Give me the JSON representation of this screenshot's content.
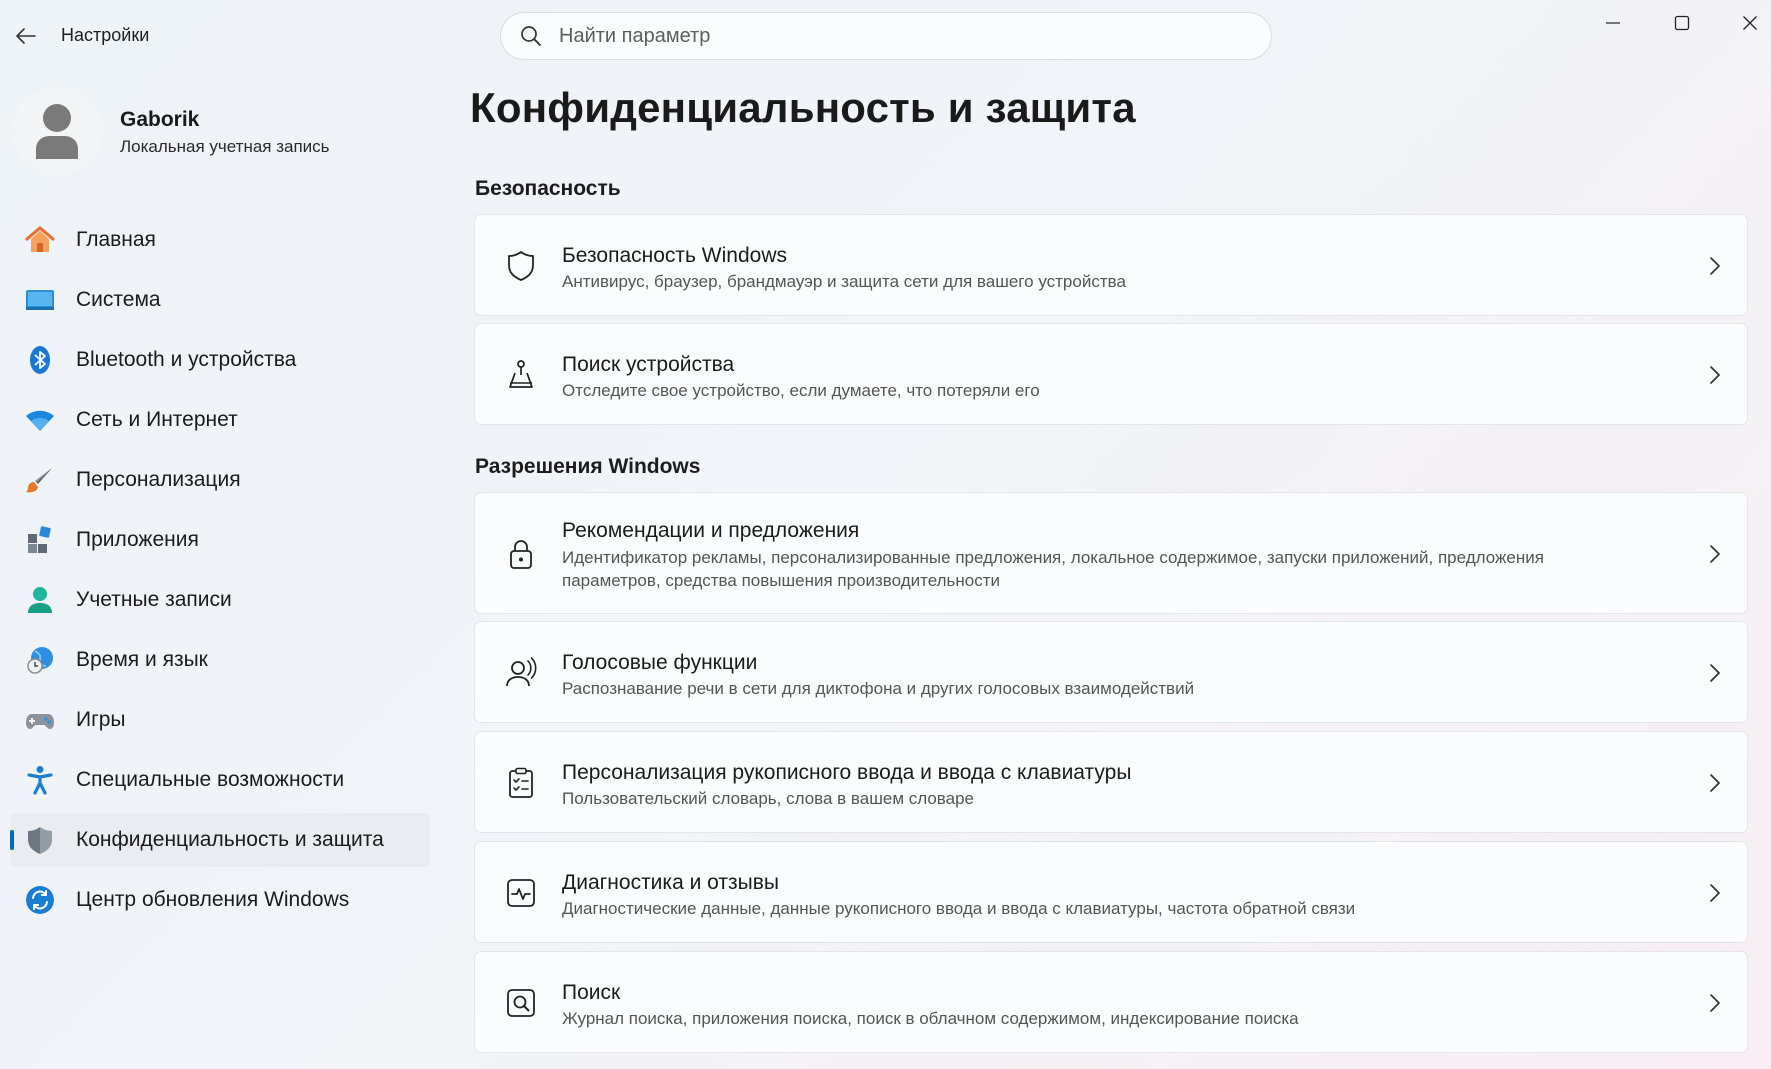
{
  "app": {
    "title": "Настройки",
    "search_placeholder": "Найти параметр"
  },
  "profile": {
    "name": "Gaborik",
    "account_type": "Локальная учетная запись"
  },
  "sidebar": {
    "items": [
      {
        "label": "Главная",
        "icon": "home-icon"
      },
      {
        "label": "Система",
        "icon": "system-icon"
      },
      {
        "label": "Bluetooth и устройства",
        "icon": "bluetooth-icon"
      },
      {
        "label": "Сеть и Интернет",
        "icon": "wifi-icon"
      },
      {
        "label": "Персонализация",
        "icon": "brush-icon"
      },
      {
        "label": "Приложения",
        "icon": "apps-icon"
      },
      {
        "label": "Учетные записи",
        "icon": "accounts-icon"
      },
      {
        "label": "Время и язык",
        "icon": "time-language-icon"
      },
      {
        "label": "Игры",
        "icon": "gamepad-icon"
      },
      {
        "label": "Специальные возможности",
        "icon": "accessibility-icon"
      },
      {
        "label": "Конфиденциальность и защита",
        "icon": "shield-icon",
        "active": true
      },
      {
        "label": "Центр обновления Windows",
        "icon": "update-icon"
      }
    ]
  },
  "main": {
    "title": "Конфиденциальность и защита",
    "sections": [
      {
        "title": "Безопасность",
        "cards": [
          {
            "title": "Безопасность Windows",
            "desc": "Антивирус, браузер, брандмауэр и защита сети для вашего устройства",
            "icon": "shield-outline-icon"
          },
          {
            "title": "Поиск устройства",
            "desc": "Отследите свое устройство, если думаете, что потеряли его",
            "icon": "find-device-icon"
          }
        ]
      },
      {
        "title": "Разрешения Windows",
        "cards": [
          {
            "title": "Рекомендации и предложения",
            "desc": "Идентификатор рекламы, персонализированные предложения, локальное содержимое, запуски приложений, предложения параметров, средства повышения производительности",
            "icon": "lock-icon"
          },
          {
            "title": "Голосовые функции",
            "desc": "Распознавание речи в сети для диктофона и других голосовых взаимодействий",
            "icon": "speech-icon"
          },
          {
            "title": "Персонализация рукописного ввода и ввода с клавиатуры",
            "desc": "Пользовательский словарь, слова в вашем словаре",
            "icon": "clipboard-list-icon"
          },
          {
            "title": "Диагностика и отзывы",
            "desc": "Диагностические данные, данные рукописного ввода и ввода с клавиатуры, частота обратной связи",
            "icon": "diagnostics-icon"
          },
          {
            "title": "Поиск",
            "desc": "Журнал поиска, приложения поиска, поиск в облачном содержимом, индексирование поиска",
            "icon": "search-box-icon"
          }
        ]
      }
    ]
  },
  "colors": {
    "accent": "#0067c0",
    "active_nav_bg": "#e9edf2",
    "card_bg": "#fbfcfd"
  }
}
